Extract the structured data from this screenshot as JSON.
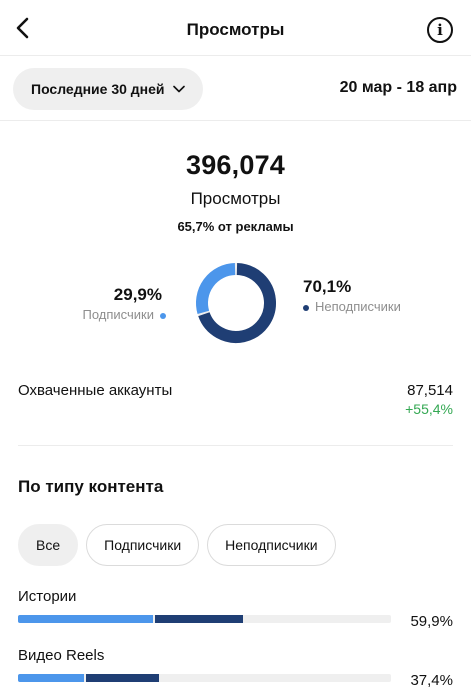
{
  "header": {
    "title": "Просмотры"
  },
  "range": {
    "selected": "Последние 30 дней",
    "dates": "20 мар - 18 апр"
  },
  "summary": {
    "total": "396,074",
    "label": "Просмотры",
    "ads_note": "65,7% от рекламы"
  },
  "split": {
    "followers": {
      "percent": "29,9%",
      "label": "Подписчики",
      "value": 29.9,
      "color": "#4c96eb"
    },
    "non_followers": {
      "percent": "70,1%",
      "label": "Неподписчики",
      "value": 70.1,
      "color": "#1f3e74"
    }
  },
  "reach": {
    "label": "Охваченные аккаунты",
    "value": "87,514",
    "change": "+55,4%"
  },
  "content": {
    "title": "По типу контента",
    "filters": [
      "Все",
      "Подписчики",
      "Неподписчики"
    ],
    "rows": [
      {
        "label": "Истории",
        "value": "59,9%",
        "followers_fraction": 0.361,
        "non_followers_fraction": 0.238
      },
      {
        "label": "Видео Reels",
        "value": "37,4%",
        "followers_fraction": 0.176,
        "non_followers_fraction": 0.198
      }
    ]
  }
}
